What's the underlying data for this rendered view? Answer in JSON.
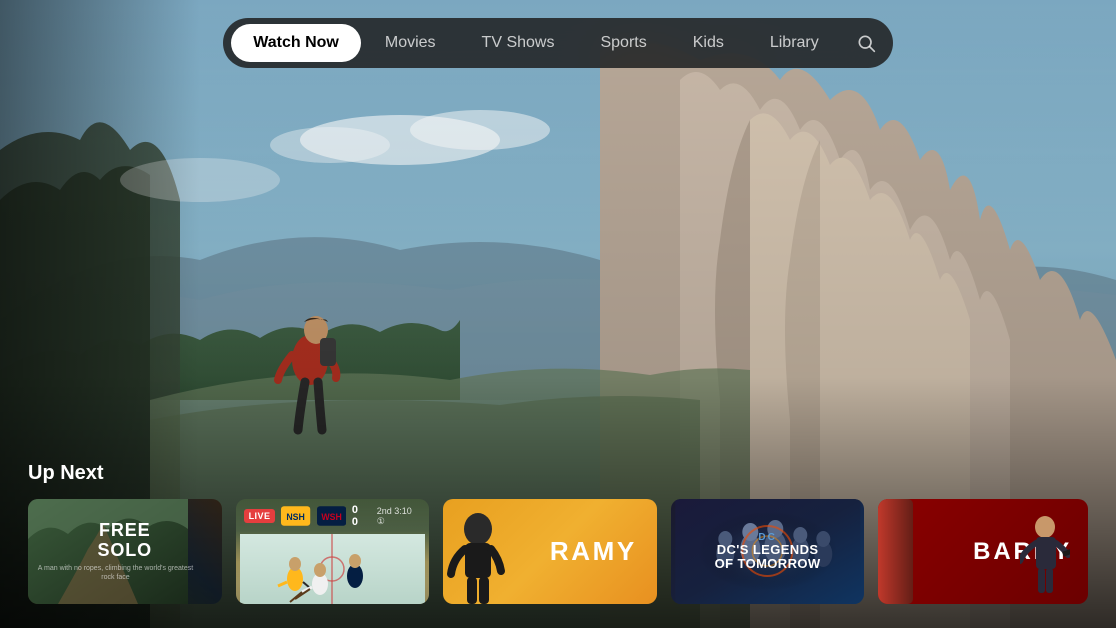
{
  "nav": {
    "items": [
      {
        "label": "Watch Now",
        "active": true
      },
      {
        "label": "Movies",
        "active": false
      },
      {
        "label": "TV Shows",
        "active": false
      },
      {
        "label": "Sports",
        "active": false
      },
      {
        "label": "Kids",
        "active": false
      },
      {
        "label": "Library",
        "active": false
      }
    ],
    "search_label": "Search"
  },
  "hero": {
    "bg_description": "Yosemite valley with hiker"
  },
  "up_next": {
    "label": "Up Next",
    "cards": [
      {
        "id": "free-solo",
        "title": "FREE SOLO",
        "subtitle": "A man with no ropes, climbing the world's greatest rock face",
        "type": "movie"
      },
      {
        "id": "hockey",
        "live_badge": "LIVE",
        "score": "0   0",
        "period": "2nd 3:10 ①",
        "type": "sports"
      },
      {
        "id": "ramy",
        "title": "RAMY",
        "type": "show"
      },
      {
        "id": "dc-legends",
        "badge": "DC",
        "title": "DC's Legends of Tomorrow",
        "type": "show"
      },
      {
        "id": "barry",
        "title": "BARRY",
        "type": "show"
      }
    ]
  }
}
